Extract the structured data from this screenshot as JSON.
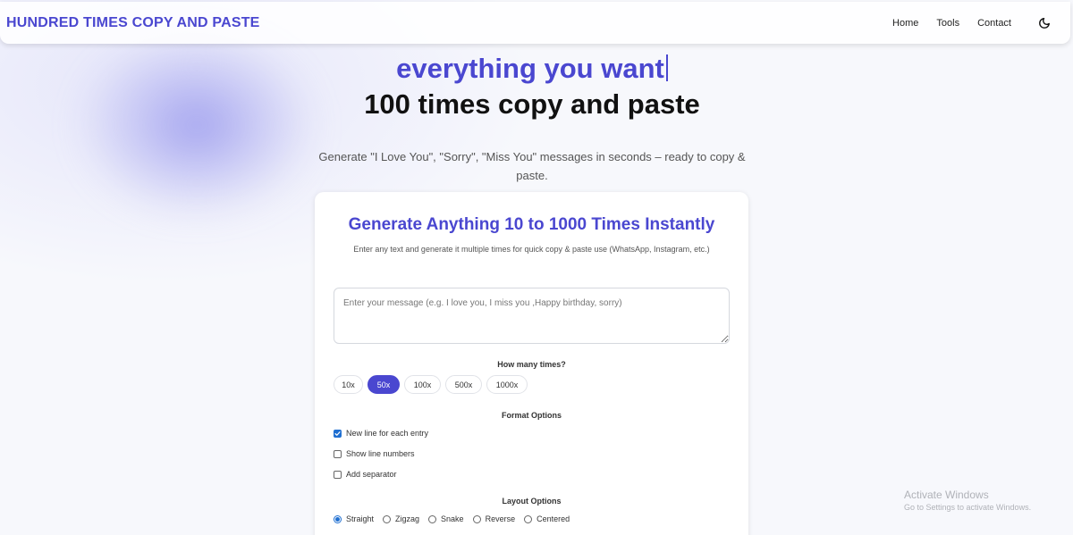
{
  "navbar": {
    "brand": "HUNDRED TIMES COPY AND PASTE",
    "links": [
      "Home",
      "Tools",
      "Contact"
    ],
    "theme_icon": "moon-icon"
  },
  "hero": {
    "typed_text": "everything you want",
    "title": "100 times copy and paste",
    "subtitle": "Generate \"I Love You\", \"Sorry\", \"Miss You\" messages in seconds – ready to copy & paste."
  },
  "card": {
    "title": "Generate Anything 10 to 1000 Times Instantly",
    "description": "Enter any text and generate it multiple times for quick copy & paste use (WhatsApp, Instagram, etc.)",
    "message_placeholder": "Enter your message (e.g. I love you, I miss you ,Happy birthday, sorry)",
    "message_value": "",
    "times_label": "How many times?",
    "times_options": [
      "10x",
      "50x",
      "100x",
      "500x",
      "1000x"
    ],
    "times_selected": "50x",
    "format_label": "Format Options",
    "format_options": [
      {
        "label": "New line for each entry",
        "checked": true
      },
      {
        "label": "Show line numbers",
        "checked": false
      },
      {
        "label": "Add separator",
        "checked": false
      }
    ],
    "layout_label": "Layout Options",
    "layout_options": [
      "Straight",
      "Zigzag",
      "Snake",
      "Reverse",
      "Centered"
    ],
    "layout_selected": "Straight"
  },
  "watermark": {
    "title": "Activate Windows",
    "subtitle": "Go to Settings to activate Windows."
  },
  "colors": {
    "accent": "#4a47d0",
    "checkbox_blue": "#1f6fd1"
  }
}
